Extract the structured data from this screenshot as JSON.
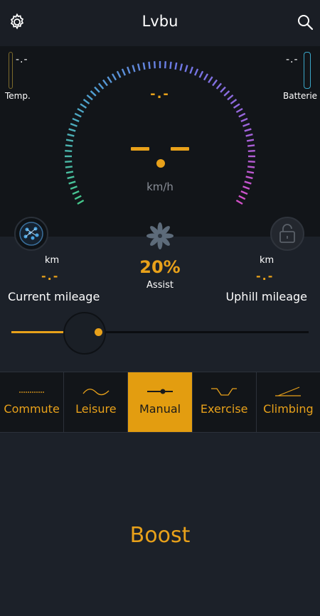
{
  "header": {
    "title": "Lvbu"
  },
  "status": {
    "temp_value": "-.-",
    "temp_label": "Temp.",
    "battery_value": "-.-",
    "battery_label": "Batterie"
  },
  "gauge": {
    "top_value": "-.-",
    "unit": "km/h"
  },
  "assist": {
    "percent": "20%",
    "label": "Assist"
  },
  "current_mileage": {
    "unit": "km",
    "value": "-.-",
    "label": "Current mileage"
  },
  "uphill_mileage": {
    "unit": "km",
    "value": "-.-",
    "label": "Uphill mileage"
  },
  "slider": {
    "level": 0.28
  },
  "modes": [
    {
      "label": "Commute"
    },
    {
      "label": "Leisure"
    },
    {
      "label": "Manual",
      "active": true
    },
    {
      "label": "Exercise"
    },
    {
      "label": "Climbing"
    }
  ],
  "boost": {
    "label": "Boost"
  },
  "colors": {
    "accent": "#e8a11a",
    "background": "#1c2129",
    "panel": "#121519"
  }
}
